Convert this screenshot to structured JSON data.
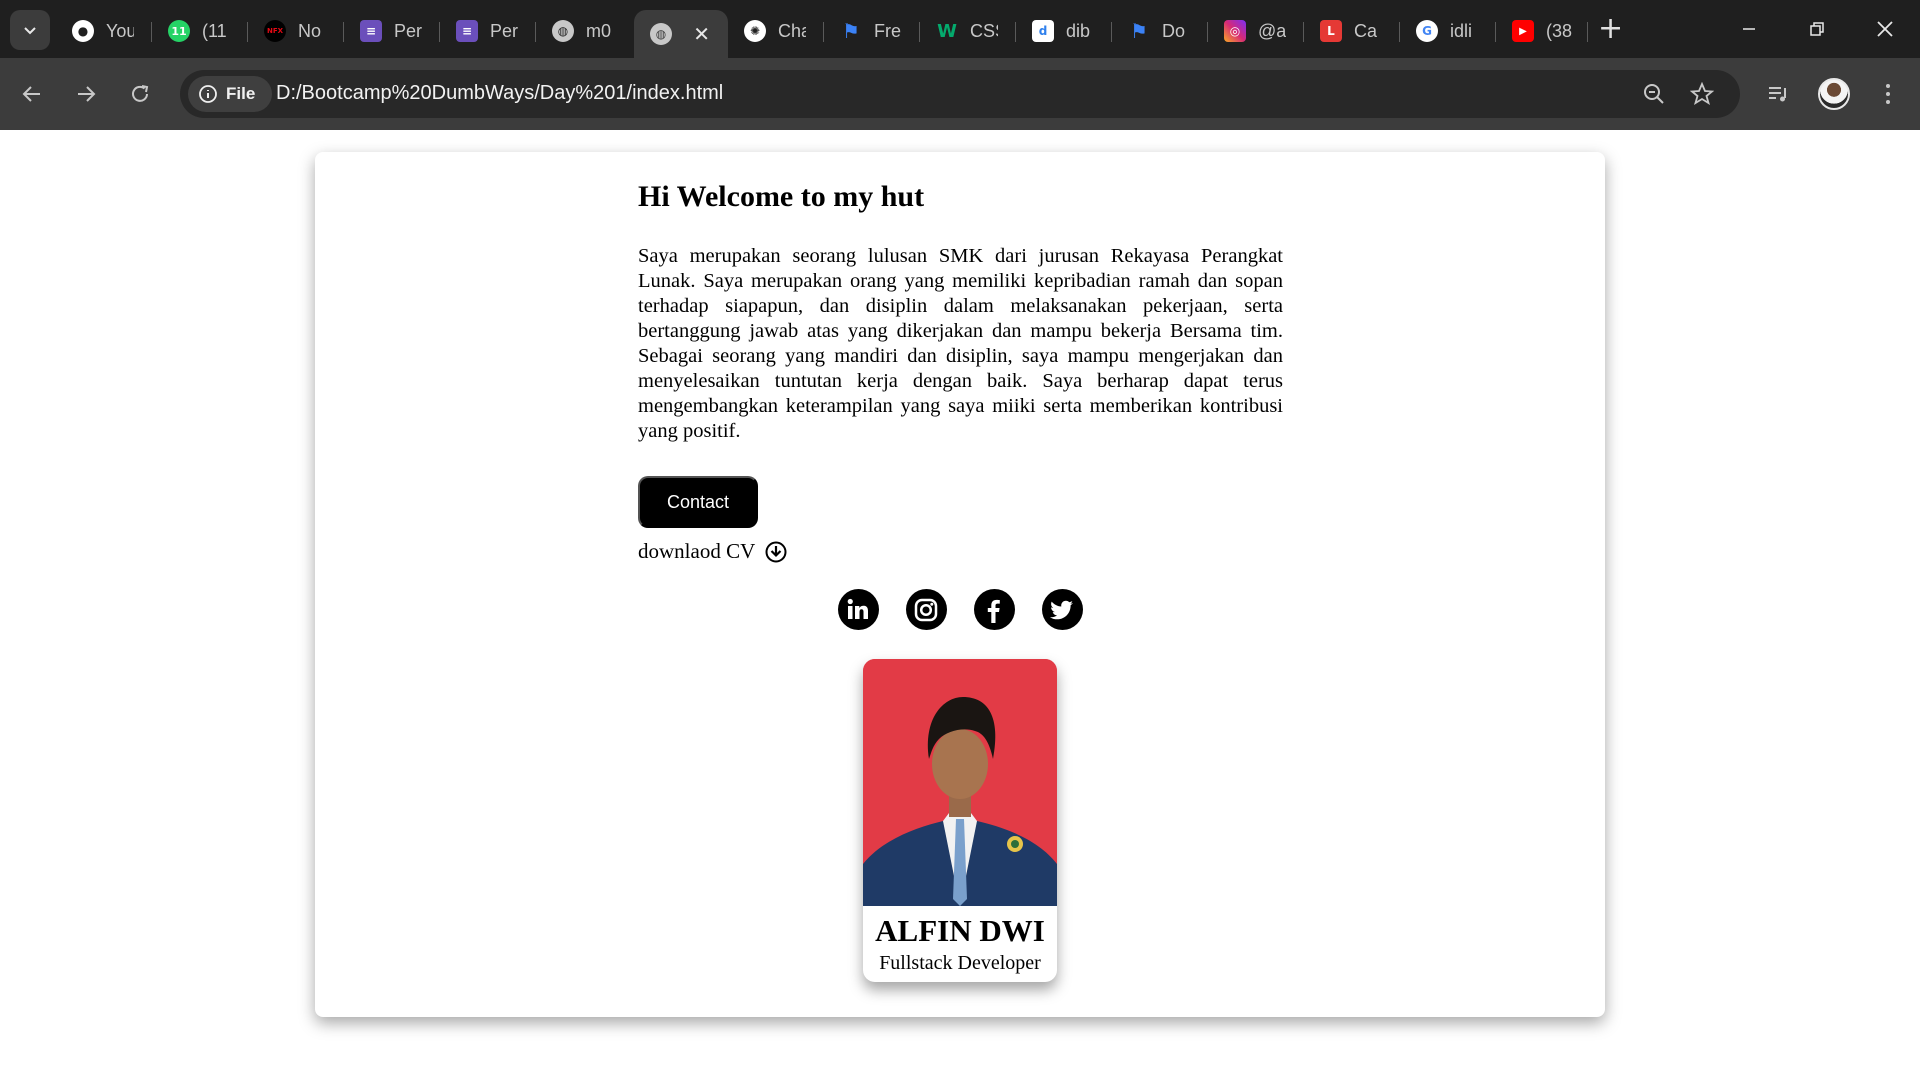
{
  "browser": {
    "tabs": [
      {
        "title": "You",
        "icon": "github-icon",
        "color": "#ffffff"
      },
      {
        "title": "(11",
        "icon": "whatsapp-icon",
        "color": "#25d366"
      },
      {
        "title": "No",
        "icon": "netflix-icon",
        "color": "#e50914"
      },
      {
        "title": "Per",
        "icon": "form-icon",
        "color": "#6b4fbb"
      },
      {
        "title": "Per",
        "icon": "form-icon",
        "color": "#6b4fbb"
      },
      {
        "title": "m0",
        "icon": "globe-icon",
        "color": "#c8c8c8"
      },
      {
        "title": "",
        "icon": "globe-icon",
        "color": "#c8c8c8",
        "active": true
      },
      {
        "title": "Cha",
        "icon": "chatgpt-icon",
        "color": "#ffffff"
      },
      {
        "title": "Fre",
        "icon": "flag-icon",
        "color": "#3b82f6"
      },
      {
        "title": "CSS",
        "icon": "w3schools-icon",
        "color": "#04aa6d"
      },
      {
        "title": "dib",
        "icon": "dibimbing-icon",
        "color": "#2f80ed"
      },
      {
        "title": "Do",
        "icon": "flag-icon",
        "color": "#3b82f6"
      },
      {
        "title": "@a",
        "icon": "instagram-icon",
        "color": "#d62976"
      },
      {
        "title": "Ca",
        "icon": "l-icon",
        "color": "#e53935"
      },
      {
        "title": "idli",
        "icon": "google-icon",
        "color": "#ffffff"
      },
      {
        "title": "(38",
        "icon": "youtube-icon",
        "color": "#ff0000"
      }
    ],
    "site_chip": "File",
    "url": "D:/Bootcamp%20DumbWays/Day%201/index.html"
  },
  "page": {
    "heading": "Hi Welcome to my hut",
    "bio": "Saya merupakan seorang lulusan SMK dari jurusan Rekayasa Perangkat Lunak. Saya merupakan orang yang memiliki kepribadian ramah dan sopan terhadap siapapun, dan disiplin dalam melaksanakan pekerjaan, serta bertanggung jawab atas yang dikerjakan dan mampu bekerja Bersama tim. Sebagai seorang yang mandiri dan disiplin, saya mampu mengerjakan dan menyelesaikan tuntutan kerja dengan baik. Saya berharap dapat terus mengembangkan keterampilan yang saya miiki serta memberikan kontribusi yang positif.",
    "contact_label": "Contact",
    "download_label": "downlaod CV",
    "socials": [
      "linkedin-icon",
      "instagram-icon",
      "facebook-icon",
      "twitter-icon"
    ],
    "profile": {
      "name": "ALFIN DWI",
      "role": "Fullstack Developer",
      "photo_bg": "#e13a45"
    }
  }
}
